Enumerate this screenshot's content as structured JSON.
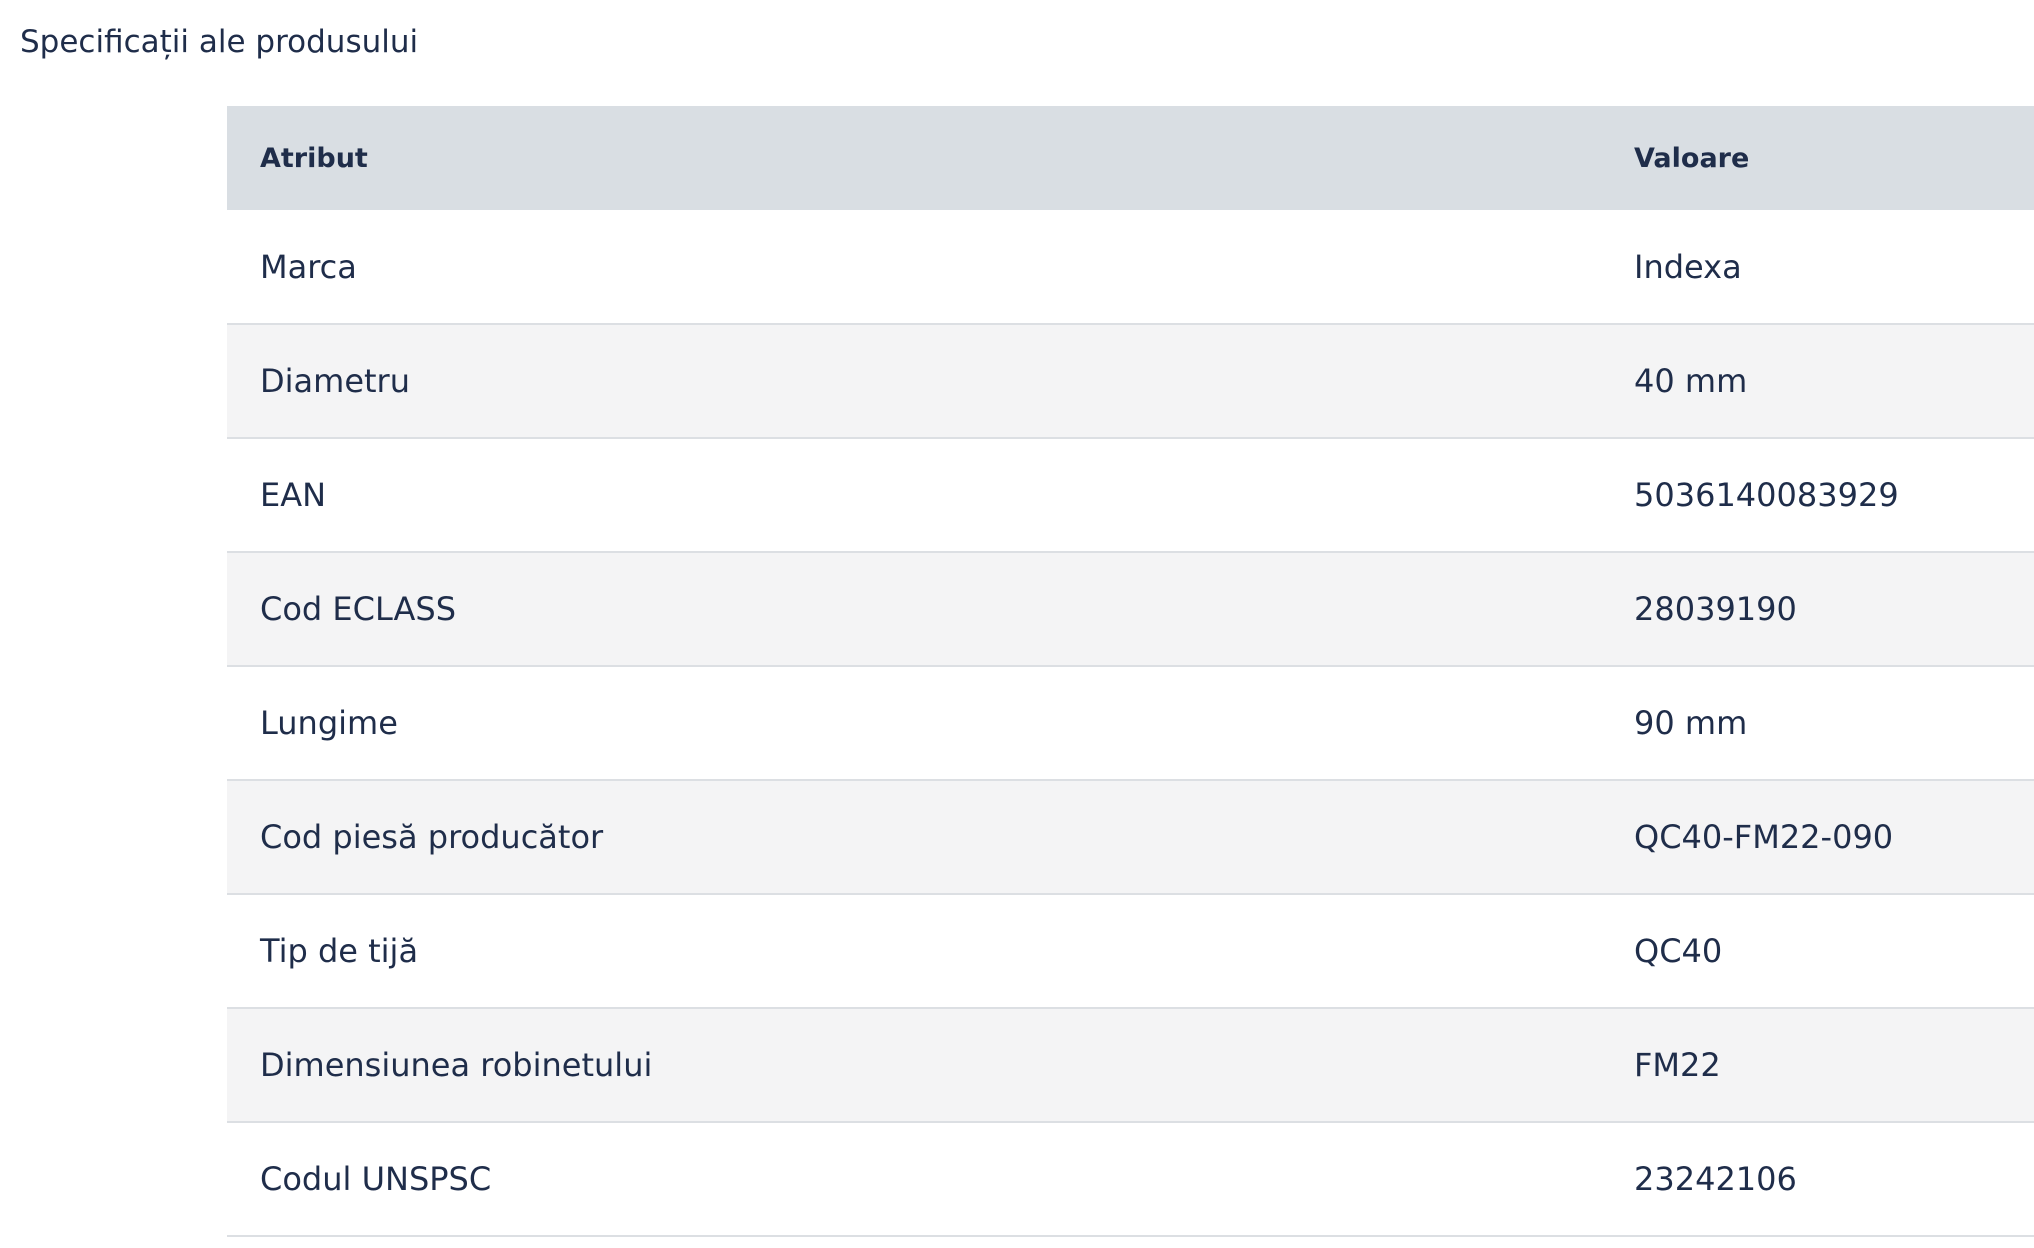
{
  "section": {
    "title": "Specificații ale produsului"
  },
  "table": {
    "headers": {
      "attribute": "Atribut",
      "value": "Valoare"
    },
    "rows": [
      {
        "attribute": "Marca",
        "value": "Indexa"
      },
      {
        "attribute": "Diametru",
        "value": "40 mm"
      },
      {
        "attribute": "EAN",
        "value": "5036140083929"
      },
      {
        "attribute": "Cod ECLASS",
        "value": "28039190"
      },
      {
        "attribute": "Lungime",
        "value": "90 mm"
      },
      {
        "attribute": "Cod piesă producător",
        "value": "QC40-FM22-090"
      },
      {
        "attribute": "Tip de tijă",
        "value": "QC40"
      },
      {
        "attribute": "Dimensiunea robinetului",
        "value": "FM22"
      },
      {
        "attribute": "Codul UNSPSC",
        "value": "23242106"
      }
    ]
  },
  "colors": {
    "text": "#1f2d4a",
    "header_bg": "#d9dee3",
    "row_alt_bg": "#f4f4f5",
    "divider": "#dcdfe3"
  }
}
